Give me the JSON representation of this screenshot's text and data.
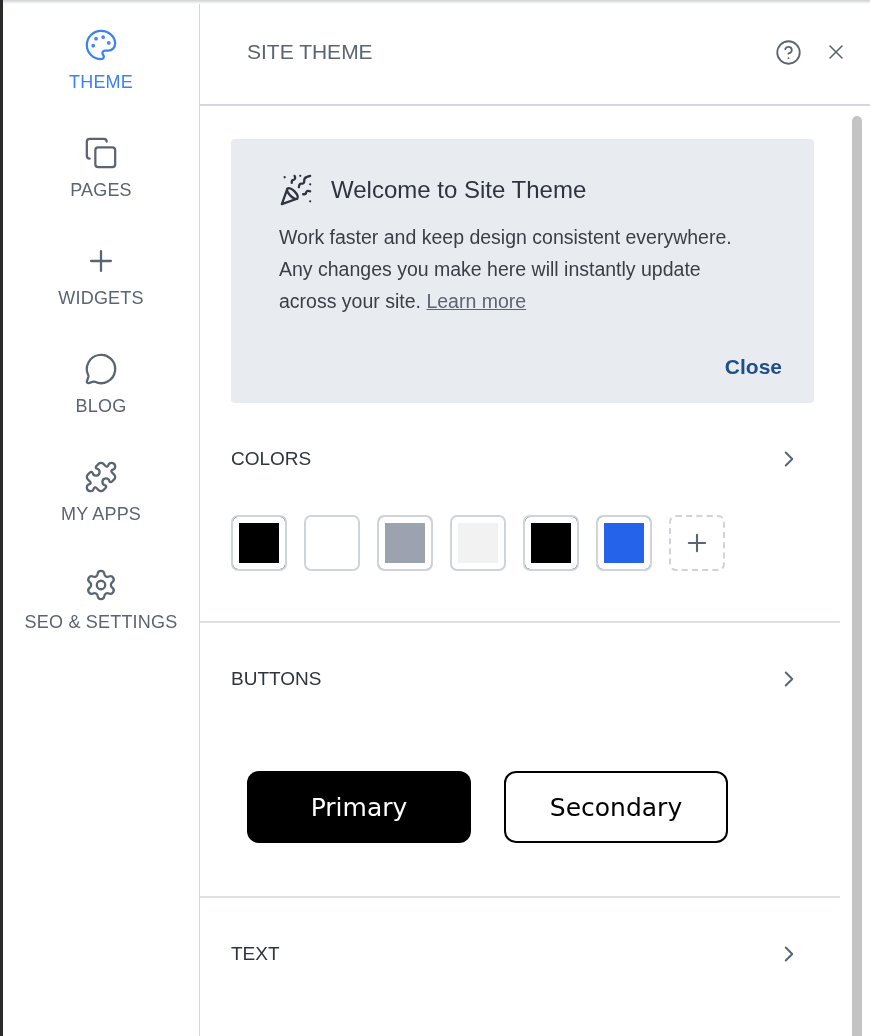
{
  "sidebar": {
    "items": [
      {
        "kind": "palette",
        "label": "THEME",
        "selected": true
      },
      {
        "kind": "pages",
        "label": "PAGES",
        "selected": false
      },
      {
        "kind": "plus",
        "label": "WIDGETS",
        "selected": false
      },
      {
        "kind": "chat",
        "label": "BLOG",
        "selected": false
      },
      {
        "kind": "puzzle",
        "label": "MY APPS",
        "selected": false
      },
      {
        "kind": "gear",
        "label": "SEO & SETTINGS",
        "selected": false
      }
    ]
  },
  "panel": {
    "title": "SITE THEME",
    "welcome": {
      "title": "Welcome to Site Theme",
      "text": "Work faster and keep design consistent everywhere. Any changes you make here will instantly update across your site.",
      "link": "Learn more",
      "close": "Close"
    },
    "colors": {
      "title": "COLORS",
      "swatches": [
        {
          "color": "#000000"
        },
        {
          "color": "#ffffff"
        },
        {
          "color": "#9ca3af"
        },
        {
          "color": "#f2f2f2"
        },
        {
          "color": "#000000"
        },
        {
          "color": "#2563eb"
        }
      ]
    },
    "buttons": {
      "title": "BUTTONS",
      "primary": "Primary",
      "secondary": "Secondary"
    },
    "text": {
      "title": "TEXT"
    }
  }
}
